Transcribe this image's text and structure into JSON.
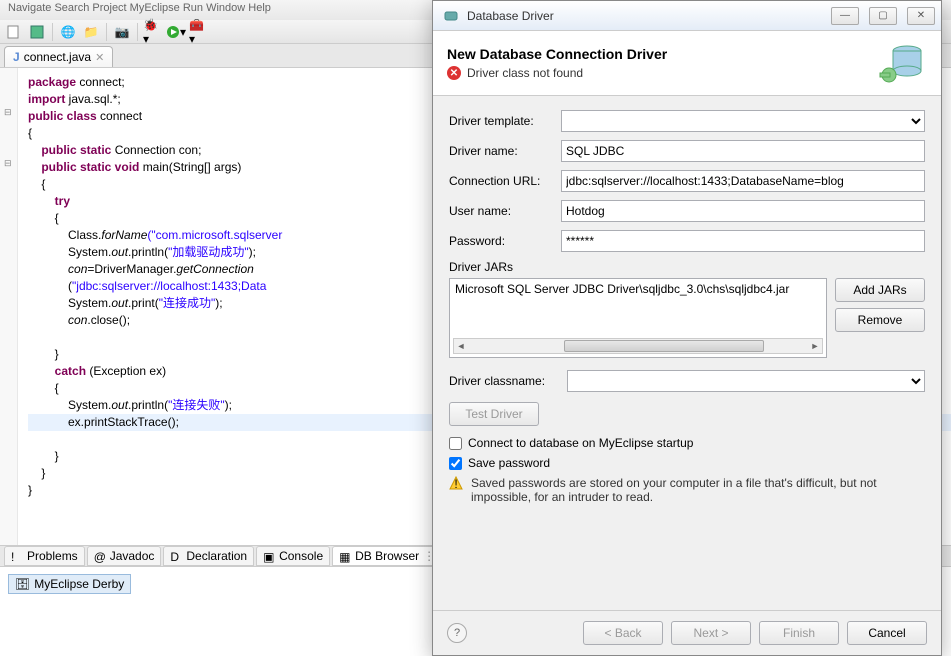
{
  "menubar": "Navigate   Search   Project   MyEclipse   Run   Window   Help",
  "editor_tab": {
    "icon": "J",
    "label": "connect.java"
  },
  "code": [
    {
      "t": "package ",
      "c": "kw",
      "r": "connect;"
    },
    {
      "t": "import ",
      "c": "kw",
      "r": "java.sql.*;"
    },
    {
      "t": "public class ",
      "c": "kw",
      "r": "connect"
    },
    {
      "t": "{",
      "c": ""
    },
    {
      "t": "    public static ",
      "c": "kw",
      "r": "Connection con;"
    },
    {
      "t": "    public static void ",
      "c": "kw",
      "r": "main(String[] args)"
    },
    {
      "t": "    {",
      "c": ""
    },
    {
      "t": "        try",
      "c": "kw"
    },
    {
      "t": "        {",
      "c": ""
    },
    {
      "t": "            Class.",
      "c": "",
      "m": "forName",
      "s": "(\"com.microsoft.sqlserver"
    },
    {
      "t": "            System.",
      "c": "",
      "m": "out",
      "p": ".println(",
      "s": "\"加载驱动成功\"",
      "e": ");"
    },
    {
      "t": "            ",
      "c": "",
      "m": "con",
      "p": "=DriverManager.",
      "m2": "getConnection"
    },
    {
      "t": "            (",
      "c": "",
      "s": "\"jdbc:sqlserver://localhost:1433;Data"
    },
    {
      "t": "            System.",
      "c": "",
      "m": "out",
      "p": ".print(",
      "s": "\"连接成功\"",
      "e": ");"
    },
    {
      "t": "            ",
      "c": "",
      "m": "con",
      "p": ".close();"
    },
    {
      "t": "",
      "c": ""
    },
    {
      "t": "        }",
      "c": ""
    },
    {
      "t": "        catch ",
      "c": "kw",
      "r": "(Exception ex)"
    },
    {
      "t": "        {",
      "c": ""
    },
    {
      "t": "            System.",
      "c": "",
      "m": "out",
      "p": ".println(",
      "s": "\"连接失败\"",
      "e": ");"
    },
    {
      "t": "            ex.printStackTrace();",
      "c": "",
      "hl": true
    },
    {
      "t": "",
      "c": ""
    },
    {
      "t": "        }",
      "c": ""
    },
    {
      "t": "    }",
      "c": ""
    },
    {
      "t": "}",
      "c": ""
    }
  ],
  "bottom_tabs": [
    {
      "icon": "!",
      "label": "Problems"
    },
    {
      "icon": "@",
      "label": "Javadoc"
    },
    {
      "icon": "D",
      "label": "Declaration"
    },
    {
      "icon": "▣",
      "label": "Console"
    },
    {
      "icon": "▦",
      "label": "DB Browser",
      "active": true
    }
  ],
  "db_item": "MyEclipse Derby",
  "dialog": {
    "title": "Database Driver",
    "header": "New Database Connection Driver",
    "error": "Driver class not found",
    "fields": {
      "template_label": "Driver template:",
      "template_value": "",
      "name_label": "Driver name:",
      "name_value": "SQL JDBC",
      "url_label": "Connection URL:",
      "url_value": "jdbc:sqlserver://localhost:1433;DatabaseName=blog",
      "user_label": "User name:",
      "user_value": "Hotdog",
      "pass_label": "Password:",
      "pass_value": "******"
    },
    "jars_label": "Driver JARs",
    "jar_item": "Microsoft SQL Server JDBC Driver\\sqljdbc_3.0\\chs\\sqljdbc4.jar",
    "add_jars": "Add JARs",
    "remove": "Remove",
    "classname_label": "Driver classname:",
    "classname_value": "",
    "test_driver": "Test Driver",
    "connect_startup": "Connect to database on MyEclipse startup",
    "save_password": "Save password",
    "warning": "Saved passwords are stored on your computer in a file that's difficult, but not impossible, for an intruder to read.",
    "buttons": {
      "back": "< Back",
      "next": "Next >",
      "finish": "Finish",
      "cancel": "Cancel"
    }
  }
}
